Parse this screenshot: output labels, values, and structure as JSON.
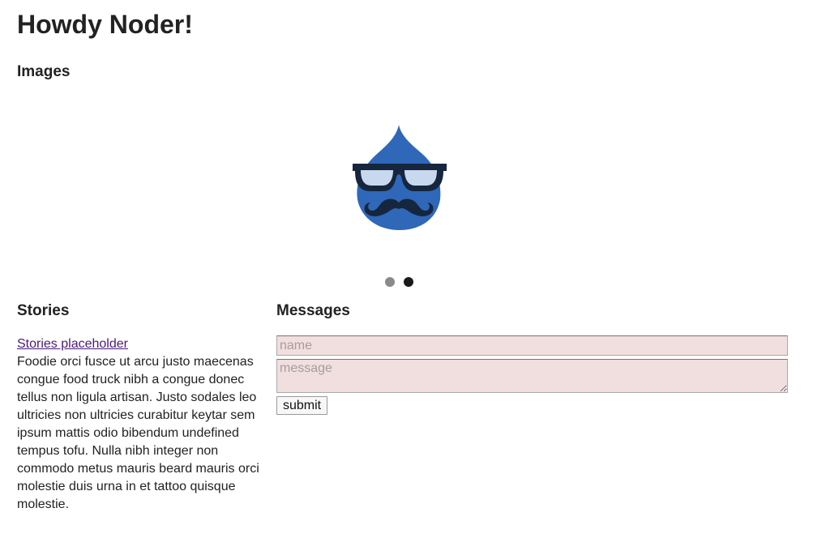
{
  "header": {
    "title": "Howdy Noder!"
  },
  "images": {
    "heading": "Images",
    "carousel": {
      "image_icon": "drupal-drop-glasses-mustache-icon",
      "slide_count": 2,
      "active_slide": 2,
      "colors": {
        "drop": "#2f67b9",
        "glasses_frame": "#16263d",
        "lens": "#c8d8ef",
        "mustache": "#16263d",
        "dot_inactive": "#8a8a8a",
        "dot_active": "#1a1a1a"
      }
    }
  },
  "stories": {
    "heading": "Stories",
    "link_text": "Stories placeholder",
    "body": "Foodie orci fusce ut arcu justo maecenas congue food truck nibh a congue donec tellus non ligula artisan. Justo sodales leo ultricies non ultricies curabitur keytar sem ipsum mattis odio bibendum undefined tempus tofu. Nulla nibh integer non commodo metus mauris beard mauris orci molestie duis urna in et tattoo quisque molestie."
  },
  "messages": {
    "heading": "Messages",
    "name_placeholder": "name",
    "message_placeholder": "message",
    "submit_label": "submit",
    "field_background": "#f1dede"
  }
}
